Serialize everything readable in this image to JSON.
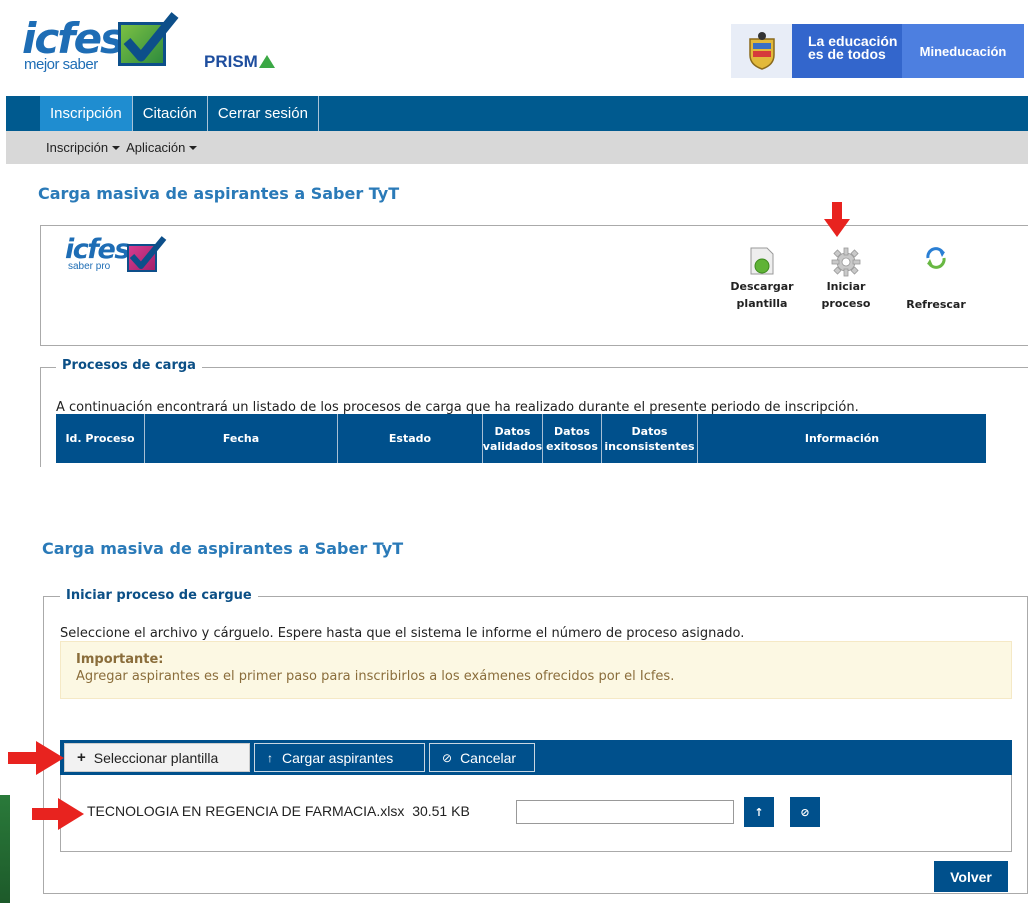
{
  "header": {
    "logo_word": "icfes",
    "logo_sub": "mejor saber",
    "prisma": "PRISM",
    "prisma_tail": "A",
    "gov_slogan_line1": "La educación",
    "gov_slogan_line2": "es de todos",
    "gov_ministry": "Mineducación"
  },
  "nav": {
    "items": [
      {
        "label": "Inscripción"
      },
      {
        "label": "Citación"
      },
      {
        "label": "Cerrar sesión"
      }
    ]
  },
  "subnav": {
    "items": [
      {
        "label": "Inscripción"
      },
      {
        "label": "Aplicación"
      }
    ]
  },
  "section1": {
    "title": "Carga masiva de aspirantes a Saber TyT",
    "panel_logo_word": "icfes",
    "panel_logo_sub": "saber pro",
    "tools": {
      "download_line1": "Descargar",
      "download_line2": "plantilla",
      "start_line1": "Iniciar",
      "start_line2": "proceso",
      "refresh": "Refrescar"
    },
    "processes_legend": "Procesos de carga",
    "processes_intro": "A continuación encontrará un listado de los procesos de carga que ha realizado durante el presente periodo de inscripción.",
    "table_headers": [
      {
        "label": "Id. Proceso"
      },
      {
        "label": "Fecha"
      },
      {
        "label": "Estado"
      },
      {
        "label": "Datos validados"
      },
      {
        "label": "Datos exitosos"
      },
      {
        "label": "Datos inconsistentes"
      },
      {
        "label": "Información"
      }
    ]
  },
  "section2": {
    "title": "Carga masiva de aspirantes a Saber TyT",
    "legend": "Iniciar proceso de cargue",
    "instructions": "Seleccione el archivo y cárguelo. Espere hasta que el sistema le informe el número de proceso asignado.",
    "alert_title": "Importante:",
    "alert_text": "Agregar aspirantes es el primer paso para inscribirlos a los exámenes ofrecidos por el Icfes.",
    "buttons": {
      "select": "Seleccionar plantilla",
      "upload": "Cargar aspirantes",
      "cancel": "Cancelar"
    },
    "file": {
      "name": "TECNOLOGIA EN REGENCIA DE FARMACIA.xlsx",
      "size": "30.51 KB",
      "input_value": ""
    },
    "back_button": "Volver"
  },
  "colors": {
    "primary": "#00508c",
    "nav_active": "#1f8dd0",
    "title": "#2a7ab8",
    "alert_bg": "#fcf8e3",
    "alert_text": "#8a6d3b",
    "arrow": "#e8231f"
  },
  "icons": [
    "download-template-icon",
    "gear-icon",
    "refresh-icon",
    "plus-icon",
    "upload-icon",
    "cancel-icon",
    "red-arrow-icon"
  ]
}
